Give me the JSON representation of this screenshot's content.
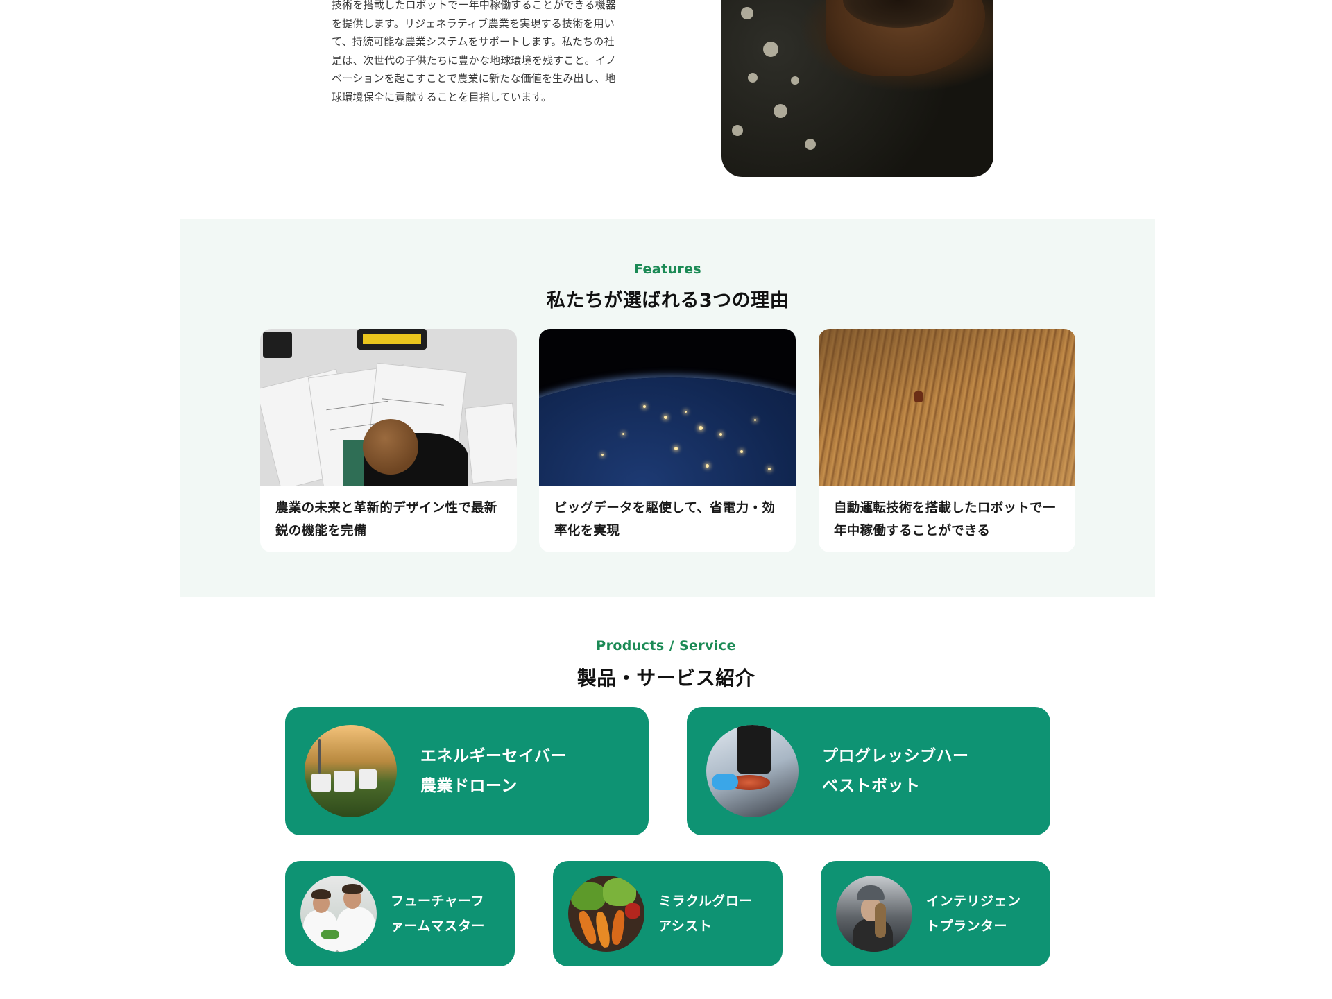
{
  "about": {
    "paragraph": "技術を搭載したロボットで一年中稼働することができる機器\nを提供します。リジェネラティブ農業を実現する技術を用い\nて、持続可能な農業システムをサポートします。私たちの社\n是は、次世代の子供たちに豊かな地球環境を残すこと。イノ\nベーションを起こすことで農業に新たな価値を生み出し、地\n球環境保全に貢献することを目指しています。",
    "image_icon": "soil-in-hands-photo"
  },
  "features": {
    "eyebrow": "Features",
    "title": "私たちが選ばれる3つの理由",
    "cards": [
      {
        "caption": "農業の未来と革新的デザイン性で最新\n鋭の機能を完備",
        "image_icon": "design-desk-photo"
      },
      {
        "caption": "ビッグデータを駆使して、省電力・効\n率化を実現",
        "image_icon": "earth-night-photo"
      },
      {
        "caption": "自動運転技術を搭載したロボットで一\n年中稼働することができる",
        "image_icon": "field-tractor-photo"
      }
    ]
  },
  "products": {
    "eyebrow": "Products / Service",
    "title": "製品・サービス紹介",
    "accent_color": "#0e9373",
    "items": [
      {
        "name": "エネルギーセイバー\n農業ドローン",
        "image_icon": "field-equipment-photo"
      },
      {
        "name": "プログレッシブハー\nベストボット",
        "image_icon": "microscope-photo"
      },
      {
        "name": "フューチャーフ\nァームマスター",
        "image_icon": "lab-researchers-photo"
      },
      {
        "name": "ミラクルグロー\nアシスト",
        "image_icon": "vegetables-photo"
      },
      {
        "name": "インテリジェン\nトプランター",
        "image_icon": "farmer-photo"
      }
    ]
  }
}
